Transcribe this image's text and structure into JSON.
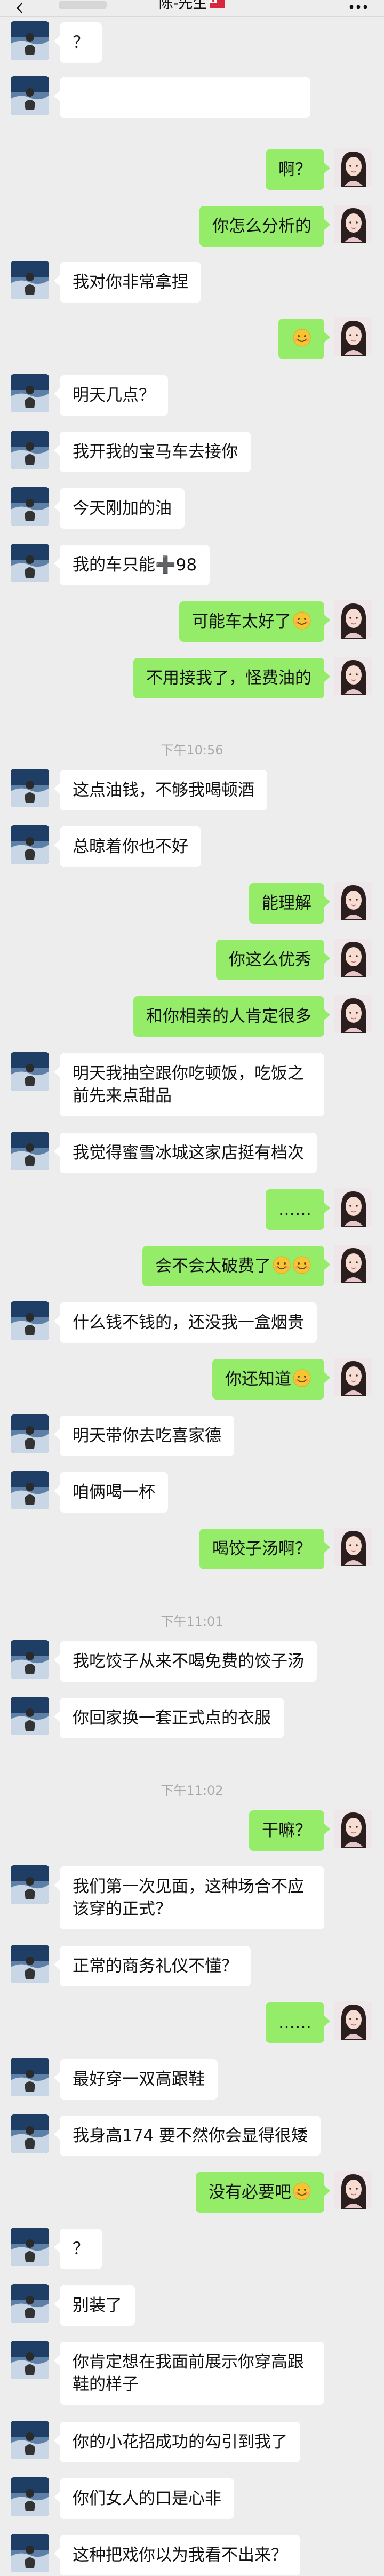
{
  "header": {
    "title": "陈-先生"
  },
  "icons": {
    "back": "chevron-left-icon",
    "more": "more-icon",
    "flag": "flag-icon",
    "emoji": "smiley-emoji-icon",
    "avatar_left": "avatar-contact",
    "avatar_right": "avatar-self"
  },
  "colors": {
    "background": "#EDEDED",
    "bubble_left": "#FFFFFF",
    "bubble_right": "#95EC69"
  },
  "messages": [
    {
      "side": "left",
      "text": "？"
    },
    {
      "side": "left",
      "text": ""
    },
    {
      "side": "right",
      "text": "啊？"
    },
    {
      "side": "right",
      "text": "你怎么分析的"
    },
    {
      "side": "left",
      "text": "我对你非常拿捏"
    },
    {
      "side": "right",
      "text": "",
      "emoji": 1
    },
    {
      "side": "left",
      "text": "明天几点？"
    },
    {
      "side": "left",
      "text": "我开我的宝马车去接你"
    },
    {
      "side": "left",
      "text": "今天刚加的油"
    },
    {
      "side": "left",
      "text": "我的车只能➕98"
    },
    {
      "side": "right",
      "text": "可能车太好了",
      "emoji": 1
    },
    {
      "side": "right",
      "text": "不用接我了，怪费油的"
    },
    {
      "time": "下午10:56"
    },
    {
      "side": "left",
      "text": "这点油钱，不够我喝顿酒"
    },
    {
      "side": "left",
      "text": "总晾着你也不好"
    },
    {
      "side": "right",
      "text": "能理解"
    },
    {
      "side": "right",
      "text": "你这么优秀"
    },
    {
      "side": "right",
      "text": "和你相亲的人肯定很多"
    },
    {
      "side": "left",
      "text": "明天我抽空跟你吃顿饭，吃饭之前先来点甜品"
    },
    {
      "side": "left",
      "text": "我觉得蜜雪冰城这家店挺有档次"
    },
    {
      "side": "right",
      "text": "……"
    },
    {
      "side": "right",
      "text": "会不会太破费了",
      "emoji": 2
    },
    {
      "side": "left",
      "text": "什么钱不钱的，还没我一盒烟贵"
    },
    {
      "side": "right",
      "text": "你还知道",
      "emoji": 1
    },
    {
      "side": "left",
      "text": "明天带你去吃喜家德"
    },
    {
      "side": "left",
      "text": "咱俩喝一杯"
    },
    {
      "side": "right",
      "text": "喝饺子汤啊？"
    },
    {
      "time": "下午11:01"
    },
    {
      "side": "left",
      "text": "我吃饺子从来不喝免费的饺子汤"
    },
    {
      "side": "left",
      "text": "你回家换一套正式点的衣服"
    },
    {
      "time": "下午11:02"
    },
    {
      "side": "right",
      "text": "干嘛？"
    },
    {
      "side": "left",
      "text": "我们第一次见面，这种场合不应该穿的正式？"
    },
    {
      "side": "left",
      "text": "正常的商务礼仪不懂？"
    },
    {
      "side": "right",
      "text": "……"
    },
    {
      "side": "left",
      "text": "最好穿一双高跟鞋"
    },
    {
      "side": "left",
      "text": "我身高174 要不然你会显得很矮"
    },
    {
      "side": "right",
      "text": "没有必要吧",
      "emoji": 1
    },
    {
      "side": "left",
      "text": "？"
    },
    {
      "side": "left",
      "text": "别装了"
    },
    {
      "side": "left",
      "text": "你肯定想在我面前展示你穿高跟鞋的样子"
    },
    {
      "side": "left",
      "text": "你的小花招成功的勾引到我了"
    },
    {
      "side": "left",
      "text": "你们女人的口是心非"
    },
    {
      "side": "left",
      "text": "这种把戏你以为我看不出来？"
    }
  ]
}
